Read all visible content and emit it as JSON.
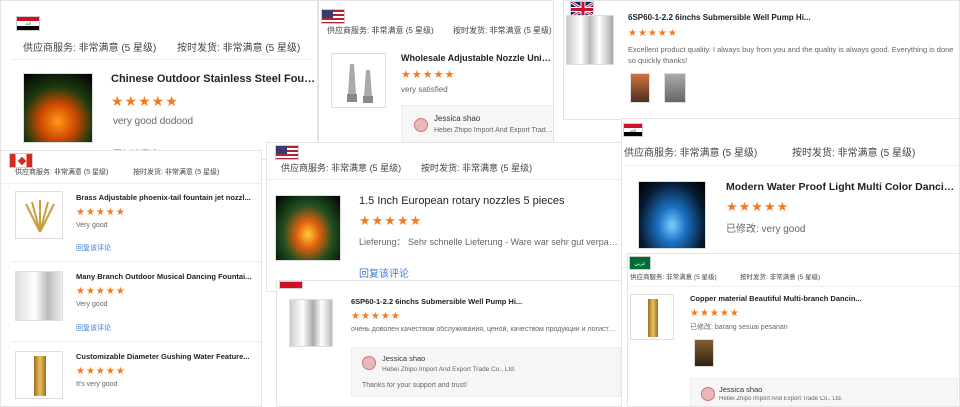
{
  "cards": {
    "c1": {
      "meta_label1": "供应商服务:",
      "meta_value1": "非常满意",
      "meta_tag1": "(5 星级)",
      "meta_label2": "按时发货:",
      "meta_value2": "非常满意",
      "meta_tag2": "(5 星级)",
      "title": "Chinese Outdoor Stainless Steel Fountain",
      "stars": "★★★★★",
      "comment": "very good dodood",
      "reply_link": "回复该评论"
    },
    "c2": {
      "meta_label1": "供应商服务:",
      "meta_value1": "非常满意",
      "meta_tag1": "(5 星级)",
      "meta_label2": "按时发货:",
      "meta_value2": "非常满意",
      "meta_tag2": "(5 星级)",
      "title": "Wholesale Adjustable Nozzle Universal",
      "stars": "★★★★★",
      "comment": "very satisfied",
      "reply_name": "Jessica shao",
      "reply_company": "Hebei Zhipo Import And Export Trade Co."
    },
    "c3": {
      "title": "6SP60-1-2.2 6inchs Submersible Well Pump Hi...",
      "stars": "★★★★★",
      "comment": "Excellent product quality. I always buy from you and the quality is always good. Everything is done so quickly thanks!"
    },
    "c4": {
      "meta_label1": "供应商服务:",
      "meta_value1": "非常满意",
      "meta_tag1": "(5 星级)",
      "meta_label2": "按时发货:",
      "meta_value2": "非常满意",
      "meta_tag2": "(5 星级)",
      "items": [
        {
          "title": "Brass Adjustable phoenix-tail fountain jet nozzl...",
          "stars": "★★★★★",
          "comment": "Very good",
          "reply_link": "回复该评论"
        },
        {
          "title": "Many Branch Outdoor Musical Dancing Fountai...",
          "stars": "★★★★★",
          "comment": "Very good",
          "reply_link": "回复该评论"
        },
        {
          "title": "Customizable Diameter Gushing Water Feature...",
          "stars": "★★★★★",
          "comment": "It's very good"
        }
      ]
    },
    "c5": {
      "meta_label1": "供应商服务:",
      "meta_value1": "非常满意",
      "meta_tag1": "(5 星级)",
      "meta_label2": "按时发货:",
      "meta_value2": "非常满意",
      "meta_tag2": "(5 星级)",
      "title": "1.5 Inch European rotary nozzles 5 pieces",
      "stars": "★★★★★",
      "comment": "Lieferung：  Sehr schnelle Lieferung - Ware war sehr gut verpackt!",
      "reply_link": "回复该评论"
    },
    "c6": {
      "title": "6SP60-1-2.2 6inchs Submersible Well Pump Hi...",
      "stars": "★★★★★",
      "comment": "очень доволен качеством обслуживания, ценой, качеством продукции и логистики",
      "reply_name": "Jessica shao",
      "reply_company": "Hebei Zhipo Import And Export Trade Co., Ltd.",
      "reply_text": "Thanks for your support and trust!"
    },
    "c7": {
      "meta_label1": "供应商服务:",
      "meta_value1": "非常满意",
      "meta_tag1": "(5 星级)",
      "meta_label2": "按时发货:",
      "meta_value2": "非常满意",
      "meta_tag2": "(5 星级)",
      "title": "Modern Water Proof Light Multi Color Dancing ...",
      "stars": "★★★★★",
      "comment": "已修改: very good"
    },
    "c8": {
      "meta_label1": "供应商服务:",
      "meta_value1": "非常满意",
      "meta_tag1": "(5 星级)",
      "meta_label2": "按时发货:",
      "meta_value2": "非常满意",
      "meta_tag2": "(5 星级)",
      "title": "Copper material Beautiful Multi-branch Dancin...",
      "stars": "★★★★★",
      "comment": "已修改: barang sesuai pesanan",
      "reply_name": "Jessica shao",
      "reply_company": "Hebei Zhipo Import And Export Trade Co., Ltd."
    }
  },
  "colors": {
    "star": "#f47a20",
    "link": "#3a7bd5"
  }
}
